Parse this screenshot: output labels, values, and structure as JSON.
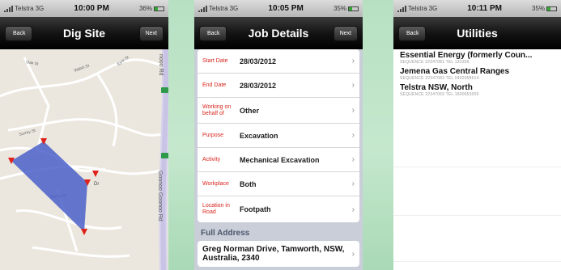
{
  "screens": [
    {
      "status": {
        "carrier": "Telstra",
        "network": "3G",
        "time": "10:00 PM",
        "battery": "36%"
      },
      "nav": {
        "back": "Back",
        "title": "Dig Site",
        "next": "Next"
      },
      "map": {
        "road_vertical": "Goonoo Goonoo Rd",
        "road_vertical_top": "nooo Rd",
        "road_dr": "Dr"
      }
    },
    {
      "status": {
        "carrier": "Telstra",
        "network": "3G",
        "time": "10:05 PM",
        "battery": "35%"
      },
      "nav": {
        "back": "Back",
        "title": "Job Details",
        "next": "Next"
      },
      "rows": [
        {
          "label": "Start Date",
          "value": "28/03/2012"
        },
        {
          "label": "End Date",
          "value": "28/03/2012"
        },
        {
          "label": "Working on behalf of",
          "value": "Other"
        },
        {
          "label": "Purpose",
          "value": "Excavation"
        },
        {
          "label": "Activity",
          "value": "Mechanical Excavation"
        },
        {
          "label": "Workplace",
          "value": "Both"
        },
        {
          "label": "Location in Road",
          "value": "Footpath"
        }
      ],
      "section": "Full Address",
      "address": "Greg Norman Drive, Tamworth, NSW, Australia, 2340"
    },
    {
      "status": {
        "carrier": "Telstra",
        "network": "3G",
        "time": "10:11 PM",
        "battery": "35%"
      },
      "nav": {
        "back": "Back",
        "title": "Utilities"
      },
      "items": [
        {
          "name": "Essential Energy (formerly Coun...",
          "detail": "SEQUENCE 22347081 TEL 132356"
        },
        {
          "name": "Jemena Gas Central Ranges",
          "detail": "SEQUENCE 22347083 TEL 0402058614"
        },
        {
          "name": "Telstra NSW, North",
          "detail": "SEQUENCE 22347069 TEL 1800653000"
        }
      ]
    }
  ],
  "colors": {
    "label_red": "#d8261e",
    "navbar": "#141414",
    "polygon": "#4a5fc9",
    "marker": "#e0201a",
    "road_green": "#2e9a4a"
  }
}
